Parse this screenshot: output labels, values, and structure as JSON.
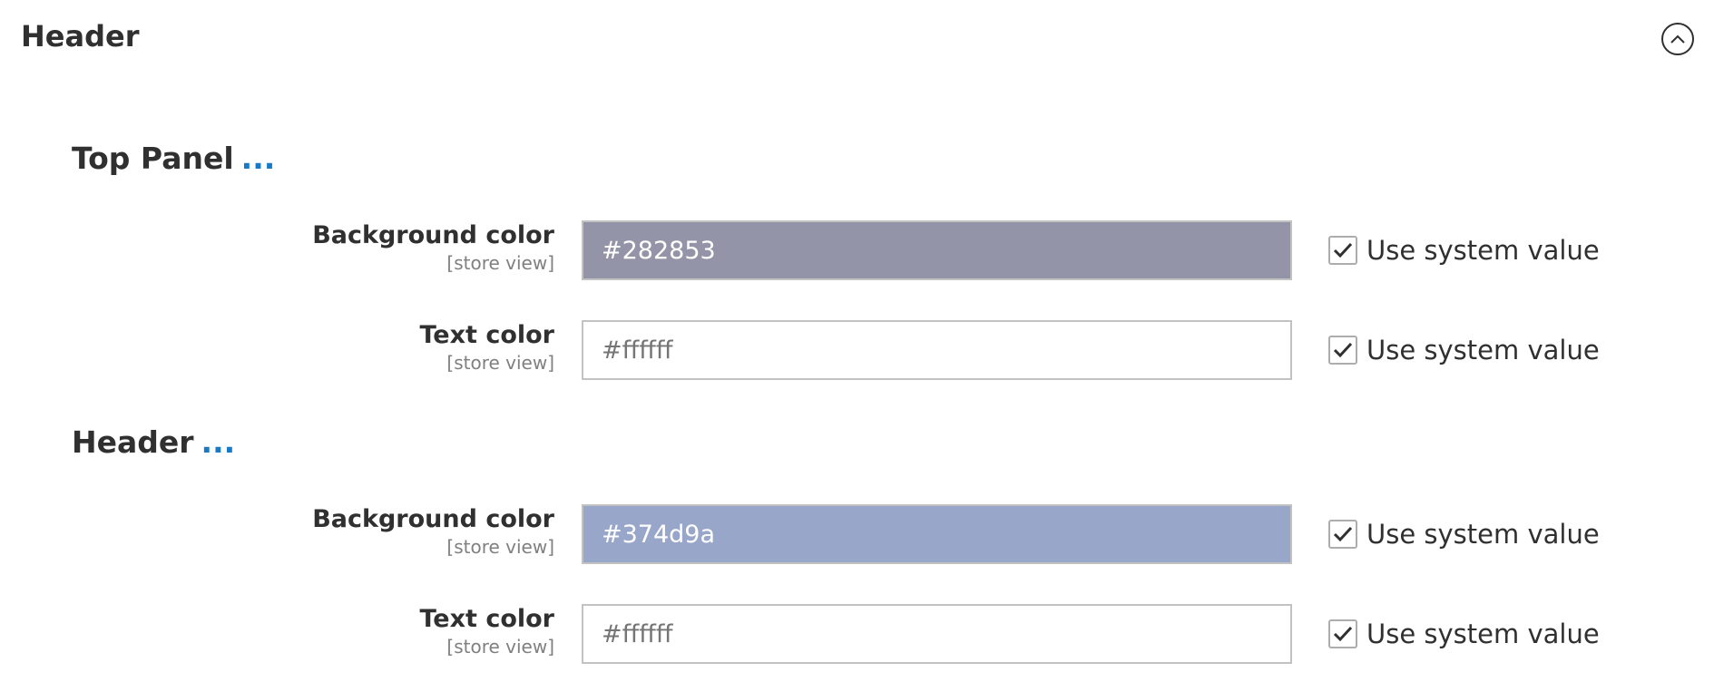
{
  "section": {
    "title": "Header"
  },
  "groups": [
    {
      "title": "Top Panel",
      "more": "...",
      "fields": [
        {
          "label": "Background color",
          "scope": "[store view]",
          "value": "#282853",
          "placeholder": "",
          "fill": "#9394a7",
          "checkbox_label": "Use system value",
          "checked": true
        },
        {
          "label": "Text color",
          "scope": "[store view]",
          "value": "",
          "placeholder": "#ffffff",
          "fill": "#ffffff",
          "checkbox_label": "Use system value",
          "checked": true
        }
      ]
    },
    {
      "title": "Header",
      "more": "...",
      "fields": [
        {
          "label": "Background color",
          "scope": "[store view]",
          "value": "#374d9a",
          "placeholder": "",
          "fill": "#98a6ca",
          "checkbox_label": "Use system value",
          "checked": true
        },
        {
          "label": "Text color",
          "scope": "[store view]",
          "value": "",
          "placeholder": "#ffffff",
          "fill": "#ffffff",
          "checkbox_label": "Use system value",
          "checked": true
        }
      ]
    }
  ],
  "icons": {
    "collapse": "chevron-up-circle-icon",
    "check": "checkmark-icon"
  }
}
